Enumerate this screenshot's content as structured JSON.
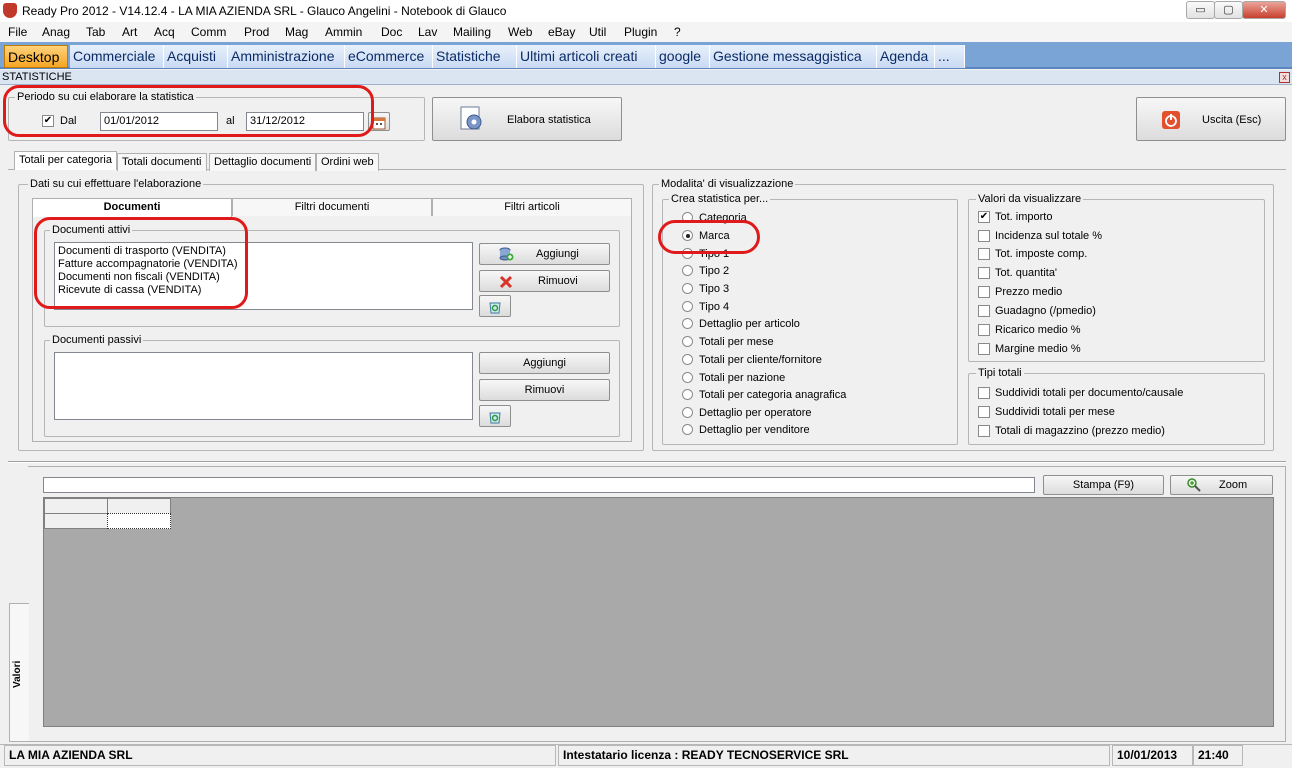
{
  "window": {
    "title": "Ready Pro 2012 - V14.12.4 - LA MIA AZIENDA SRL - Glauco Angelini - Notebook di Glauco",
    "minimize": "▭",
    "restore": "▢",
    "close": "✕"
  },
  "menu": [
    "File",
    "Anag",
    "Tab",
    "Art",
    "Acq",
    "Comm",
    "Prod",
    "Mag",
    "Ammin",
    "Doc",
    "Lav",
    "Mailing",
    "Web",
    "eBay",
    "Util",
    "Plugin",
    "?"
  ],
  "tabs": [
    "Desktop",
    "Commerciale",
    "Acquisti",
    "Amministrazione",
    "eCommerce",
    "Statistiche",
    "Ultimi articoli creati",
    "google",
    "Gestione messaggistica",
    "Agenda",
    "..."
  ],
  "panel": {
    "title": "STATISTICHE",
    "close": "x"
  },
  "period": {
    "group_label": "Periodo su cui elaborare la statistica",
    "from_checked": true,
    "from_label": "Dal",
    "from_value": "01/01/2012",
    "to_label": "al",
    "to_value": "31/12/2012"
  },
  "buttons": {
    "elabora": "Elabora statistica",
    "uscita": "Uscita (Esc)"
  },
  "subtabs": [
    "Totali per categoria",
    "Totali documenti",
    "Dettaglio documenti",
    "Ordini web"
  ],
  "dati": {
    "group_label": "Dati su cui effettuare l'elaborazione",
    "tabs": [
      "Documenti",
      "Filtri documenti",
      "Filtri articoli"
    ],
    "attivi_label": "Documenti attivi",
    "attivi_items": [
      "Documenti di trasporto (VENDITA)",
      "Fatture accompagnatorie (VENDITA)",
      "Documenti non fiscali (VENDITA)",
      "Ricevute di cassa (VENDITA)"
    ],
    "passivi_label": "Documenti passivi",
    "passivi_items": [],
    "add": "Aggiungi",
    "remove": "Rimuovi"
  },
  "modalita": {
    "group_label": "Modalita' di visualizzazione",
    "crea_label": "Crea statistica per...",
    "options": [
      "Categoria",
      "Marca",
      "Tipo 1",
      "Tipo 2",
      "Tipo 3",
      "Tipo 4",
      "Dettaglio per articolo",
      "Totali per mese",
      "Totali per cliente/fornitore",
      "Totali per nazione",
      "Totali per categoria anagrafica",
      "Dettaglio per operatore",
      "Dettaglio per venditore"
    ],
    "selected": "Marca",
    "valori_label": "Valori da visualizzare",
    "valori": [
      {
        "label": "Tot. importo",
        "checked": true
      },
      {
        "label": "Incidenza sul totale %",
        "checked": false
      },
      {
        "label": "Tot. imposte comp.",
        "checked": false
      },
      {
        "label": "Tot. quantita'",
        "checked": false
      },
      {
        "label": "Prezzo medio",
        "checked": false
      },
      {
        "label": "Guadagno (/pmedio)",
        "checked": false
      },
      {
        "label": "Ricarico medio %",
        "checked": false
      },
      {
        "label": "Margine medio %",
        "checked": false
      }
    ],
    "tipi_label": "Tipi totali",
    "tipi": [
      {
        "label": "Suddividi totali per documento/causale",
        "checked": false
      },
      {
        "label": "Suddividi totali per mese",
        "checked": false
      },
      {
        "label": "Totali di magazzino (prezzo medio)",
        "checked": false
      }
    ]
  },
  "results": {
    "side_tab": "Valori",
    "stampa": "Stampa (F9)",
    "zoom": "Zoom"
  },
  "status": {
    "company": "LA MIA AZIENDA SRL",
    "license": "Intestatario licenza : READY TECNOSERVICE SRL",
    "date": "10/01/2013",
    "time": "21:40"
  },
  "colors": {
    "accent_tab": "#f6a623",
    "tabbar": "#7ba4d6",
    "annotation": "#e01a1a"
  }
}
